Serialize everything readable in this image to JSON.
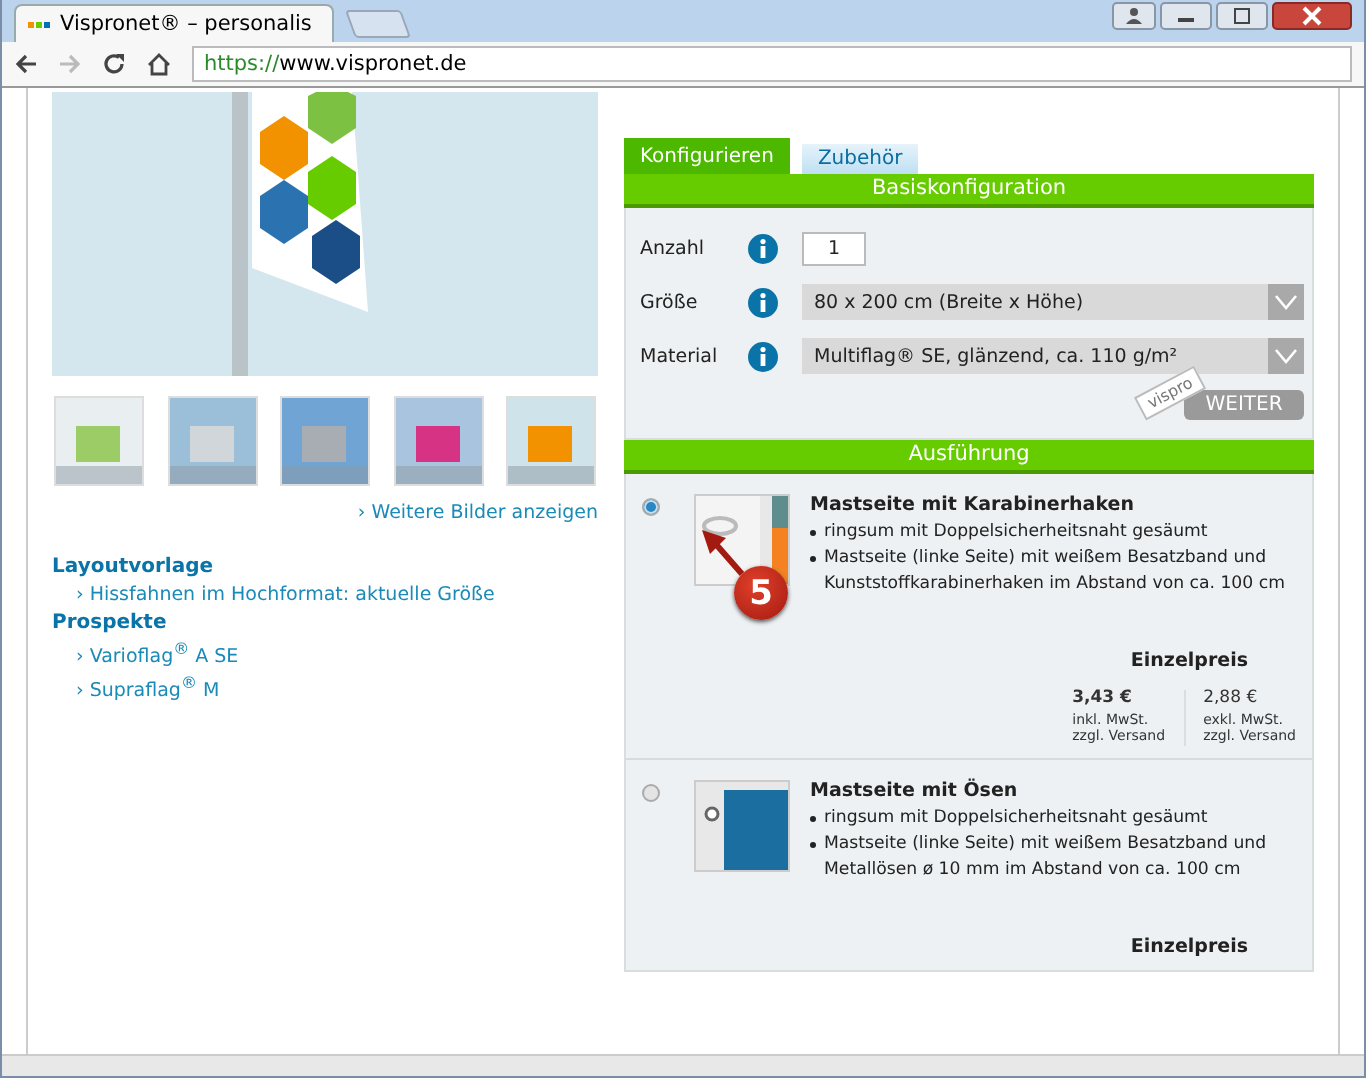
{
  "browser": {
    "tab_title": "Vispronet® – personalis",
    "url_scheme": "https://",
    "url_host": "www.vispronet.de"
  },
  "gallery": {
    "more_link": "› Weitere Bilder anzeigen"
  },
  "downloads": [
    {
      "heading": "Layoutvorlage",
      "links": [
        "› Hissfahnen im Hochformat: aktuelle Größe"
      ]
    },
    {
      "heading": "Prospekte",
      "links": [
        "› Varioflag$^{®}$ A SE",
        "› Supraflag$^{®}$ M"
      ]
    }
  ],
  "tabs": [
    {
      "label": "Konfigurieren",
      "selected": true
    },
    {
      "label": "Zubehör",
      "selected": false
    }
  ],
  "config": {
    "header": "Basiskonfiguration",
    "fields": [
      {
        "kind": "number",
        "label": "Anzahl",
        "value": "1"
      },
      {
        "kind": "select",
        "label": "Größe",
        "value": "80 x 200 cm (Breite x Höhe)"
      },
      {
        "kind": "select",
        "label": "Material",
        "value": "Multiflag® SE, glänzend, ca. 110 g/m²"
      }
    ],
    "logo": "vispro",
    "next_button": {
      "label": "WEITER",
      "disabled": true
    }
  },
  "execution": {
    "header": "Ausführung",
    "options": [
      {
        "kind": "hook",
        "selected": true,
        "title": "Mastseite mit Karabinerhaken",
        "bullets": [
          "ringsum mit Doppelsicherheitsnaht gesäumt",
          "Mastseite (linke Seite) mit weißem Besatzband und Kunststoffkarabinerhaken im Abstand von ca. 100 cm"
        ],
        "price_header": "Einzelpreis",
        "prices": [
          {
            "kind": "gross",
            "amount": "3,43 €",
            "notes": [
              "inkl. MwSt.",
              "zzgl. Versand"
            ]
          },
          {
            "kind": "net",
            "amount": "2,88 €",
            "notes": [
              "exkl. MwSt.",
              "zzgl. Versand"
            ]
          }
        ],
        "callout": "5"
      },
      {
        "kind": "grommet",
        "selected": false,
        "title": "Mastseite mit Ösen",
        "bullets": [
          "ringsum mit Doppelsicherheitsnaht gesäumt",
          "Mastseite (linke Seite) mit weißem Besatzband und Metallösen ø 10 mm im Abstand von ca. 100 cm"
        ],
        "price_header": "Einzelpreis"
      }
    ]
  }
}
